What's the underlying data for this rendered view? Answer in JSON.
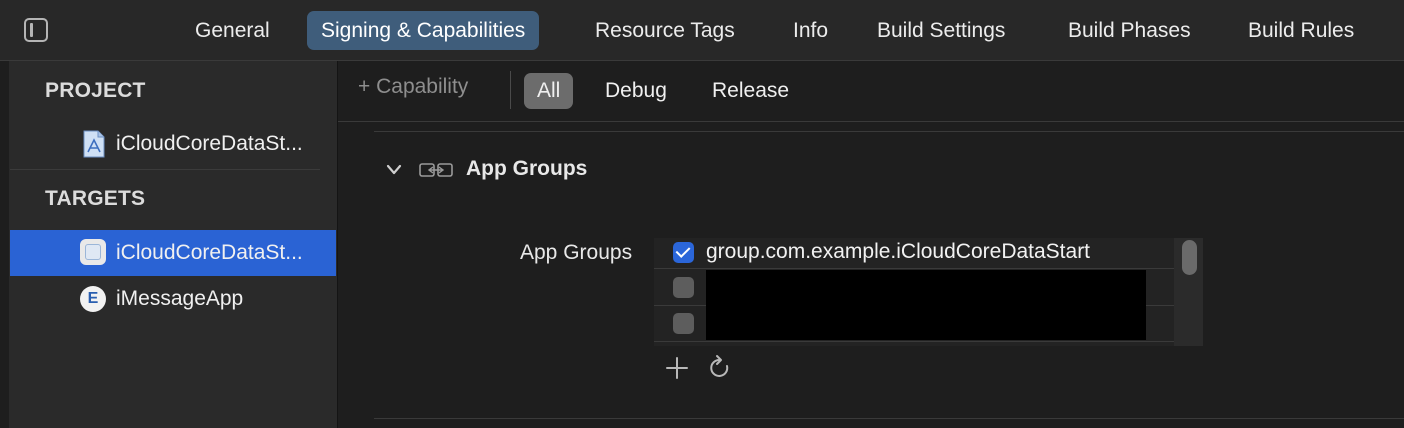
{
  "tabs": [
    {
      "label": "General",
      "active": false
    },
    {
      "label": "Signing & Capabilities",
      "active": true
    },
    {
      "label": "Resource Tags",
      "active": false
    },
    {
      "label": "Info",
      "active": false
    },
    {
      "label": "Build Settings",
      "active": false
    },
    {
      "label": "Build Phases",
      "active": false
    },
    {
      "label": "Build Rules",
      "active": false
    }
  ],
  "sidebar": {
    "project_header": "PROJECT",
    "project_item": "iCloudCoreDataSt...",
    "targets_header": "TARGETS",
    "targets": [
      {
        "label": "iCloudCoreDataSt...",
        "selected": true,
        "icon": "app-target-icon"
      },
      {
        "label": "iMessageApp",
        "selected": false,
        "icon": "extension-e-icon"
      }
    ]
  },
  "toolbar": {
    "capability_label": "+ Capability",
    "filters": [
      {
        "label": "All",
        "active": true
      },
      {
        "label": "Debug",
        "active": false
      },
      {
        "label": "Release",
        "active": false
      }
    ]
  },
  "capability": {
    "title": "App Groups",
    "field_label": "App Groups",
    "groups": [
      {
        "label": "group.com.example.iCloudCoreDataStart",
        "checked": true
      },
      {
        "label": "",
        "checked": false,
        "redacted": true
      },
      {
        "label": "",
        "checked": false,
        "redacted": true
      }
    ],
    "add_icon": "plus-icon",
    "refresh_icon": "refresh-icon"
  },
  "colors": {
    "accent": "#2a63d4",
    "selected_tab": "#3f5d7b",
    "background": "#1e1e1e"
  }
}
